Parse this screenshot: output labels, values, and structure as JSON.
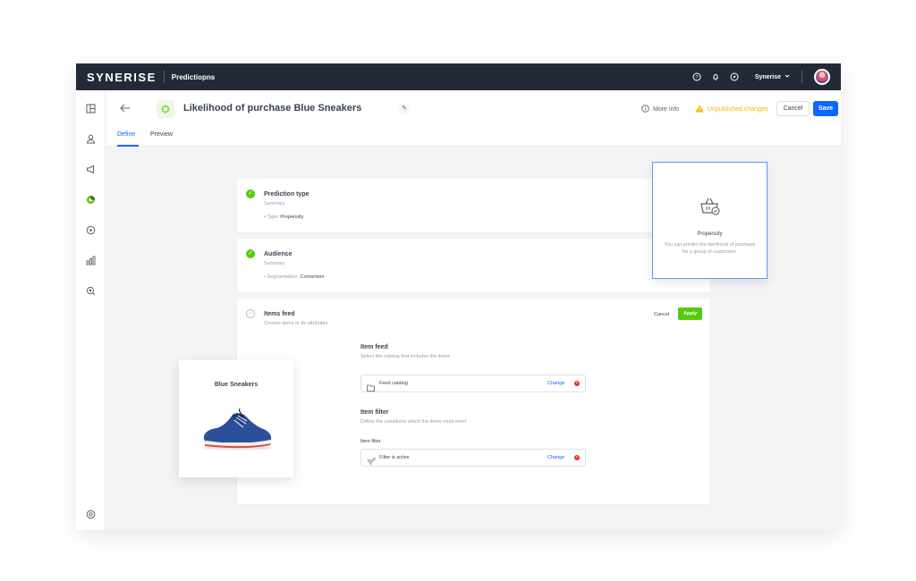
{
  "topbar": {
    "logo": "SYNERISE",
    "module": "Predictiopns",
    "org_name": "Synerise",
    "icons": [
      "help-icon",
      "bell-icon",
      "compass-icon",
      "chevron-down-icon"
    ]
  },
  "sidebar": {
    "items": [
      "dashboard-icon",
      "user-icon",
      "megaphone-icon",
      "ai-icon",
      "play-icon",
      "analytics-icon",
      "search-data-icon",
      "settings-icon"
    ]
  },
  "header": {
    "title": "Likelihood of purchase Blue Sneakers",
    "more_info": "More info",
    "unpublished": "Unpublished changes",
    "cancel_label": "Cancel",
    "save_label": "Save",
    "more_label": "···",
    "tabs": [
      {
        "label": "Define",
        "active": true
      },
      {
        "label": "Preview",
        "active": false
      }
    ]
  },
  "cards": {
    "prediction": {
      "title": "Prediction type",
      "subtitle": "Summary",
      "bullet_key": "Type:",
      "bullet_value": "Propensity"
    },
    "audience": {
      "title": "Audience",
      "subtitle": "Summary",
      "bullet_key": "Segmentation:",
      "bullet_value": "Converters"
    },
    "items_feed": {
      "title": "Items feed",
      "subtitle": "Choose items or its attributes",
      "cancel_label": "Cancel",
      "apply_label": "Apply",
      "item_feed": {
        "title": "Item feed",
        "subtitle": "Select the catalog that includes the items",
        "field_value": "Feed catalog",
        "change_label": "Change"
      },
      "item_filter": {
        "title": "Item filter",
        "subtitle": "Define the conditions which the items must meet",
        "field_label": "Item filter",
        "field_value": "Filter is active",
        "change_label": "Change"
      }
    }
  },
  "propensity_card": {
    "title": "Propensity",
    "description": "You can predict the likelihood of purchase for a group of customers."
  },
  "product_card": {
    "title": "Blue Sneakers"
  },
  "colors": {
    "accent": "#0b68ff",
    "success": "#54cb0b",
    "warning": "#fab700",
    "danger": "#f52922",
    "topbar": "#232a37"
  }
}
